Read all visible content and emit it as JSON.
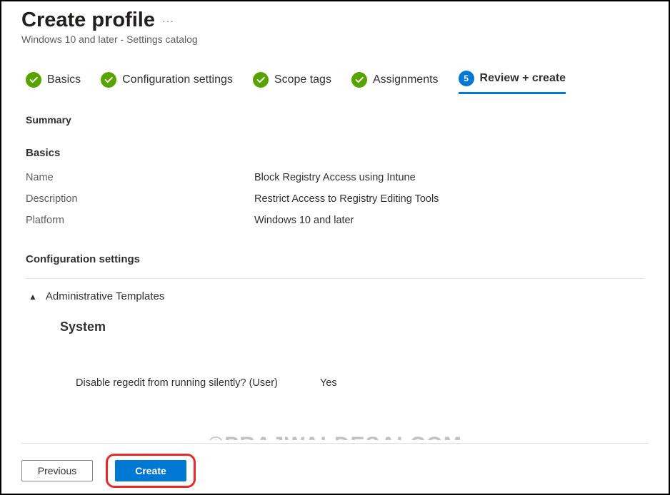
{
  "header": {
    "title": "Create profile",
    "menu_dots": "···",
    "subtitle": "Windows 10 and later - Settings catalog"
  },
  "stepper": {
    "steps": [
      {
        "label": "Basics",
        "state": "done"
      },
      {
        "label": "Configuration settings",
        "state": "done"
      },
      {
        "label": "Scope tags",
        "state": "done"
      },
      {
        "label": "Assignments",
        "state": "done"
      },
      {
        "label": "Review + create",
        "state": "current",
        "number": "5"
      }
    ]
  },
  "summary": {
    "heading": "Summary",
    "basics_heading": "Basics",
    "basics_rows": [
      {
        "key": "Name",
        "val": "Block Registry Access using Intune"
      },
      {
        "key": "Description",
        "val": "Restrict Access to Registry Editing Tools"
      },
      {
        "key": "Platform",
        "val": "Windows 10 and later"
      }
    ],
    "config_heading": "Configuration settings",
    "expander_label": "Administrative Templates",
    "group_heading": "System",
    "setting": {
      "label": "Disable regedit from running silently? (User)",
      "value": "Yes"
    }
  },
  "footer": {
    "previous": "Previous",
    "create": "Create"
  },
  "watermark": "©PRAJWALDESAI.COM"
}
